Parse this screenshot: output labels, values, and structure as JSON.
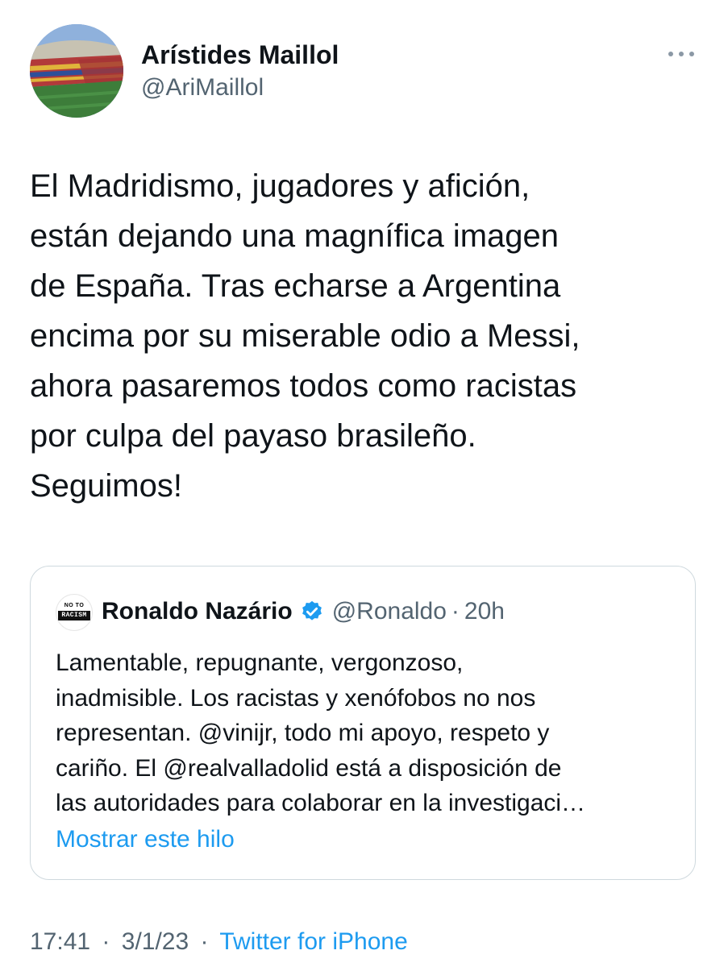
{
  "author": {
    "name": "Arístides Maillol",
    "handle": "@AriMaillol"
  },
  "icons": {
    "avatar": "stadium-photo-avatar",
    "more": "more-options-icon",
    "verified": "verified-badge-icon"
  },
  "tweet": {
    "text": "El Madridismo, jugadores y afición,\nestán dejando una magnífica imagen\nde España. Tras echarse a Argentina\nencima por su miserable odio a Messi,\nahora pasaremos todos como racistas\npor culpa del payaso brasileño.\nSeguimos!"
  },
  "quote": {
    "avatar_top": "NO TO",
    "avatar_bottom": "RACISM",
    "name": "Ronaldo Nazário",
    "handle": "@Ronaldo",
    "separator": "·",
    "time": "20h",
    "text": "Lamentable, repugnante, vergonzoso,\ninadmisible. Los racistas y xenófobos no nos\nrepresentan. @vinijr, todo mi apoyo, respeto y\ncariño. El @realvalladolid está a disposición de\nlas autoridades para colaborar en la investigaci…",
    "show_thread": "Mostrar este hilo"
  },
  "footer": {
    "time": "17:41",
    "sep1": "·",
    "date": "3/1/23",
    "sep2": "·",
    "source": "Twitter for iPhone"
  },
  "colors": {
    "text": "#0f1419",
    "secondary": "#536471",
    "link": "#1d9bf0",
    "border": "#cfd9de"
  }
}
